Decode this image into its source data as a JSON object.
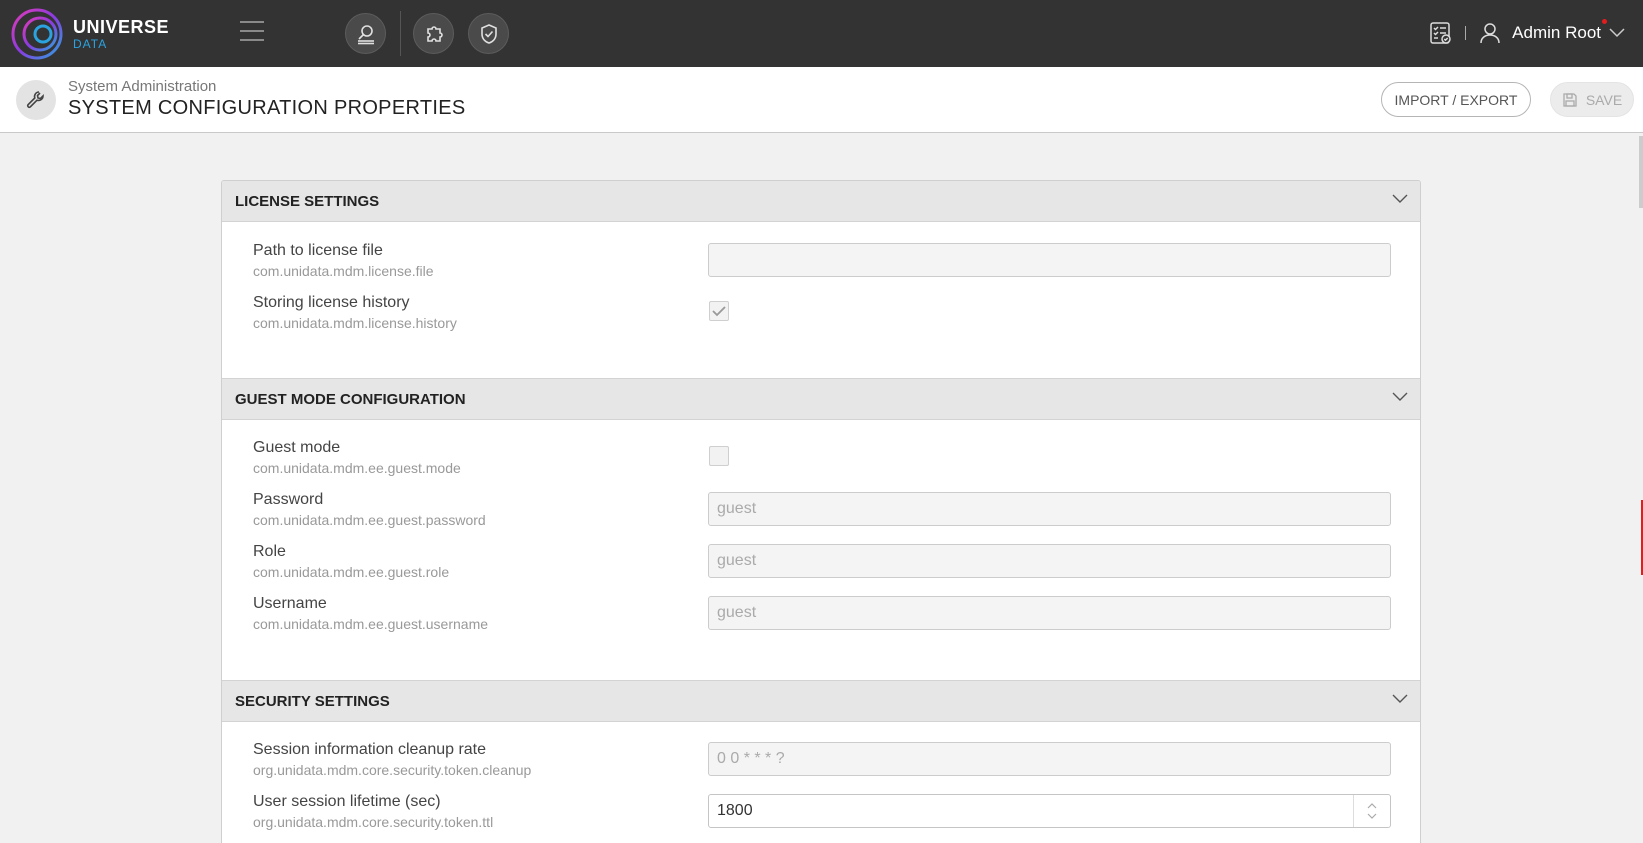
{
  "brand": {
    "line1": "UNIVERSE",
    "line2": "DATA"
  },
  "topnav": {
    "buttons": [
      "data-search-icon",
      "puzzle-icon",
      "shield-check-icon"
    ],
    "user": "Admin Root"
  },
  "header": {
    "subtitle": "System Administration",
    "title": "SYSTEM CONFIGURATION PROPERTIES",
    "import_export": "IMPORT / EXPORT",
    "save": "SAVE"
  },
  "sections": {
    "license": {
      "title": "LICENSE SETTINGS",
      "props": [
        {
          "label": "Path to license file",
          "key": "com.unidata.mdm.license.file",
          "value": ""
        },
        {
          "label": "Storing license history",
          "key": "com.unidata.mdm.license.history",
          "checked": true
        }
      ]
    },
    "guest": {
      "title": "GUEST MODE CONFIGURATION",
      "props": [
        {
          "label": "Guest mode",
          "key": "com.unidata.mdm.ee.guest.mode",
          "checked": false
        },
        {
          "label": "Password",
          "key": "com.unidata.mdm.ee.guest.password",
          "value": "guest"
        },
        {
          "label": "Role",
          "key": "com.unidata.mdm.ee.guest.role",
          "value": "guest"
        },
        {
          "label": "Username",
          "key": "com.unidata.mdm.ee.guest.username",
          "value": "guest"
        }
      ]
    },
    "security": {
      "title": "SECURITY SETTINGS",
      "props": [
        {
          "label": "Session information cleanup rate",
          "key": "org.unidata.mdm.core.security.token.cleanup",
          "value": "0 0 * * * ?"
        },
        {
          "label": "User session lifetime (sec)",
          "key": "org.unidata.mdm.core.security.token.ttl",
          "value": "1800"
        }
      ]
    }
  },
  "colors": {
    "topbar": "#333333",
    "accent": "#2aa3e0",
    "logo_ring": "#c13be0"
  }
}
